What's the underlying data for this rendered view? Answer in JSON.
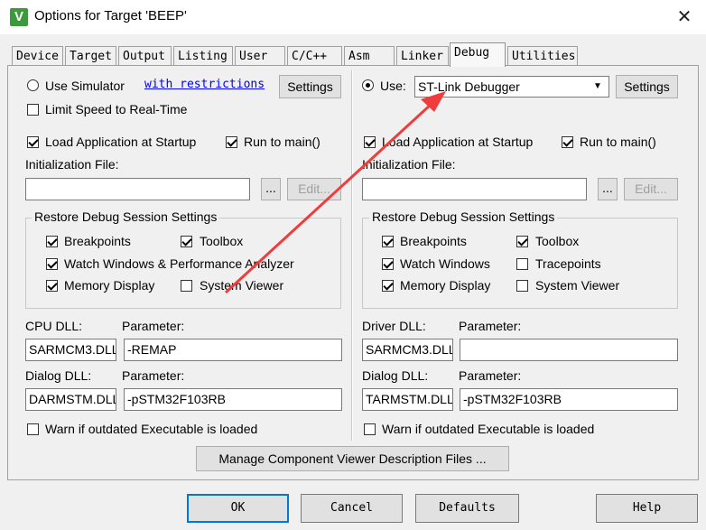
{
  "window": {
    "title": "Options for Target 'BEEP'",
    "close_glyph": "✕",
    "app_icon_glyph": "V"
  },
  "tabs": [
    {
      "label": "Device"
    },
    {
      "label": "Target"
    },
    {
      "label": "Output"
    },
    {
      "label": "Listing"
    },
    {
      "label": "User"
    },
    {
      "label": "C/C++"
    },
    {
      "label": "Asm"
    },
    {
      "label": "Linker"
    },
    {
      "label": "Debug",
      "active": true
    },
    {
      "label": "Utilities"
    }
  ],
  "left": {
    "use_simulator_label": "Use Simulator",
    "use_simulator_selected": false,
    "restrictions_link": "with restrictions",
    "settings_button": "Settings",
    "limit_speed_label": "Limit Speed to Real-Time",
    "limit_speed_checked": false,
    "load_app_label": "Load Application at Startup",
    "run_to_main_label": "Run to main()",
    "init_file_label": "Initialization File:",
    "init_file_value": "",
    "browse_button": "...",
    "edit_button": "Edit...",
    "restore_group_title": "Restore Debug Session Settings",
    "breakpoints_label": "Breakpoints",
    "toolbox_label": "Toolbox",
    "watch_label": "Watch Windows & Performance Analyzer",
    "memory_label": "Memory Display",
    "system_viewer_label": "System Viewer",
    "cpu_dll_label": "CPU DLL:",
    "cpu_param_label": "Parameter:",
    "cpu_dll_value": "SARMCM3.DLL",
    "cpu_param_value": "-REMAP",
    "dialog_dll_label": "Dialog DLL:",
    "dialog_param_label": "Parameter:",
    "dialog_dll_value": "DARMSTM.DLL",
    "dialog_param_value": "-pSTM32F103RB",
    "warn_label": "Warn if outdated Executable is loaded"
  },
  "right": {
    "use_label": "Use:",
    "use_selected": true,
    "debugger_value": "ST-Link Debugger",
    "settings_button": "Settings",
    "load_app_label": "Load Application at Startup",
    "run_to_main_label": "Run to main()",
    "init_file_label": "Initialization File:",
    "init_file_value": "",
    "browse_button": "...",
    "edit_button": "Edit...",
    "restore_group_title": "Restore Debug Session Settings",
    "breakpoints_label": "Breakpoints",
    "toolbox_label": "Toolbox",
    "watch_label": "Watch Windows",
    "tracepoints_label": "Tracepoints",
    "memory_label": "Memory Display",
    "system_viewer_label": "System Viewer",
    "driver_dll_label": "Driver DLL:",
    "driver_param_label": "Parameter:",
    "driver_dll_value": "SARMCM3.DLL",
    "driver_param_value": "",
    "dialog_dll_label": "Dialog DLL:",
    "dialog_param_label": "Parameter:",
    "dialog_dll_value": "TARMSTM.DLL",
    "dialog_param_value": "-pSTM32F103RB",
    "warn_label": "Warn if outdated Executable is loaded"
  },
  "manage_button": "Manage Component Viewer Description Files ...",
  "footer": {
    "ok": "OK",
    "cancel": "Cancel",
    "defaults": "Defaults",
    "help": "Help"
  },
  "colors": {
    "annotation_arrow": "#f03c3c",
    "dialog_bg": "#f0f0f0",
    "focus_border": "#0078d7"
  }
}
